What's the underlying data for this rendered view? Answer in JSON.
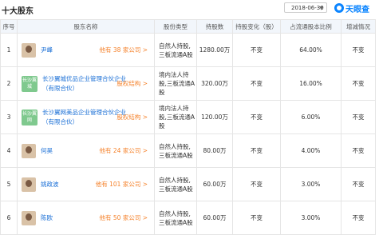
{
  "header": {
    "title": "十大股东",
    "date": "2018-06-30",
    "date_caret": "▼",
    "brand": "天眼查"
  },
  "table": {
    "columns": [
      "序号",
      "股东名称",
      "股份类型",
      "持股数",
      "持股变化（股）",
      "占流通股本比例",
      "增减情况"
    ],
    "rows": [
      {
        "num": "1",
        "avatar": "photo",
        "avatar_text": "",
        "name": "尹峰",
        "link": "他有 38 家公司 >",
        "type": "自然人持股,三板流通A股",
        "shares": "1280.00万",
        "change": "不变",
        "ratio": "64.00%",
        "trend": "不变"
      },
      {
        "num": "2",
        "avatar": "text",
        "avatar_text": "长沙翼城",
        "name": "长沙翼城优品企业管理合伙企业（有限合伙）",
        "link": "股权结构 >",
        "type": "境内法人持股,三板流通A股",
        "shares": "320.00万",
        "change": "不变",
        "ratio": "16.00%",
        "trend": "不变"
      },
      {
        "num": "3",
        "avatar": "text",
        "avatar_text": "长沙翼网",
        "name": "长沙翼网美品企业管理合伙企业（有限合伙）",
        "link": "股权结构 >",
        "type": "境内法人持股,三板流通A股",
        "shares": "120.00万",
        "change": "不变",
        "ratio": "6.00%",
        "trend": "不变"
      },
      {
        "num": "4",
        "avatar": "photo",
        "avatar_text": "",
        "name": "何昊",
        "link": "他有 24 家公司 >",
        "type": "自然人持股,三板流通A股",
        "shares": "80.00万",
        "change": "不变",
        "ratio": "4.00%",
        "trend": "不变"
      },
      {
        "num": "5",
        "avatar": "photo",
        "avatar_text": "",
        "name": "姚政波",
        "link": "他有 101 家公司 >",
        "type": "自然人持股,三板流通A股",
        "shares": "60.00万",
        "change": "不变",
        "ratio": "3.00%",
        "trend": "不变"
      },
      {
        "num": "6",
        "avatar": "photo",
        "avatar_text": "",
        "name": "陈欧",
        "link": "他有 50 家公司 >",
        "type": "自然人持股,三板流通A股",
        "shares": "60.00万",
        "change": "不变",
        "ratio": "3.00%",
        "trend": "不变"
      }
    ]
  }
}
